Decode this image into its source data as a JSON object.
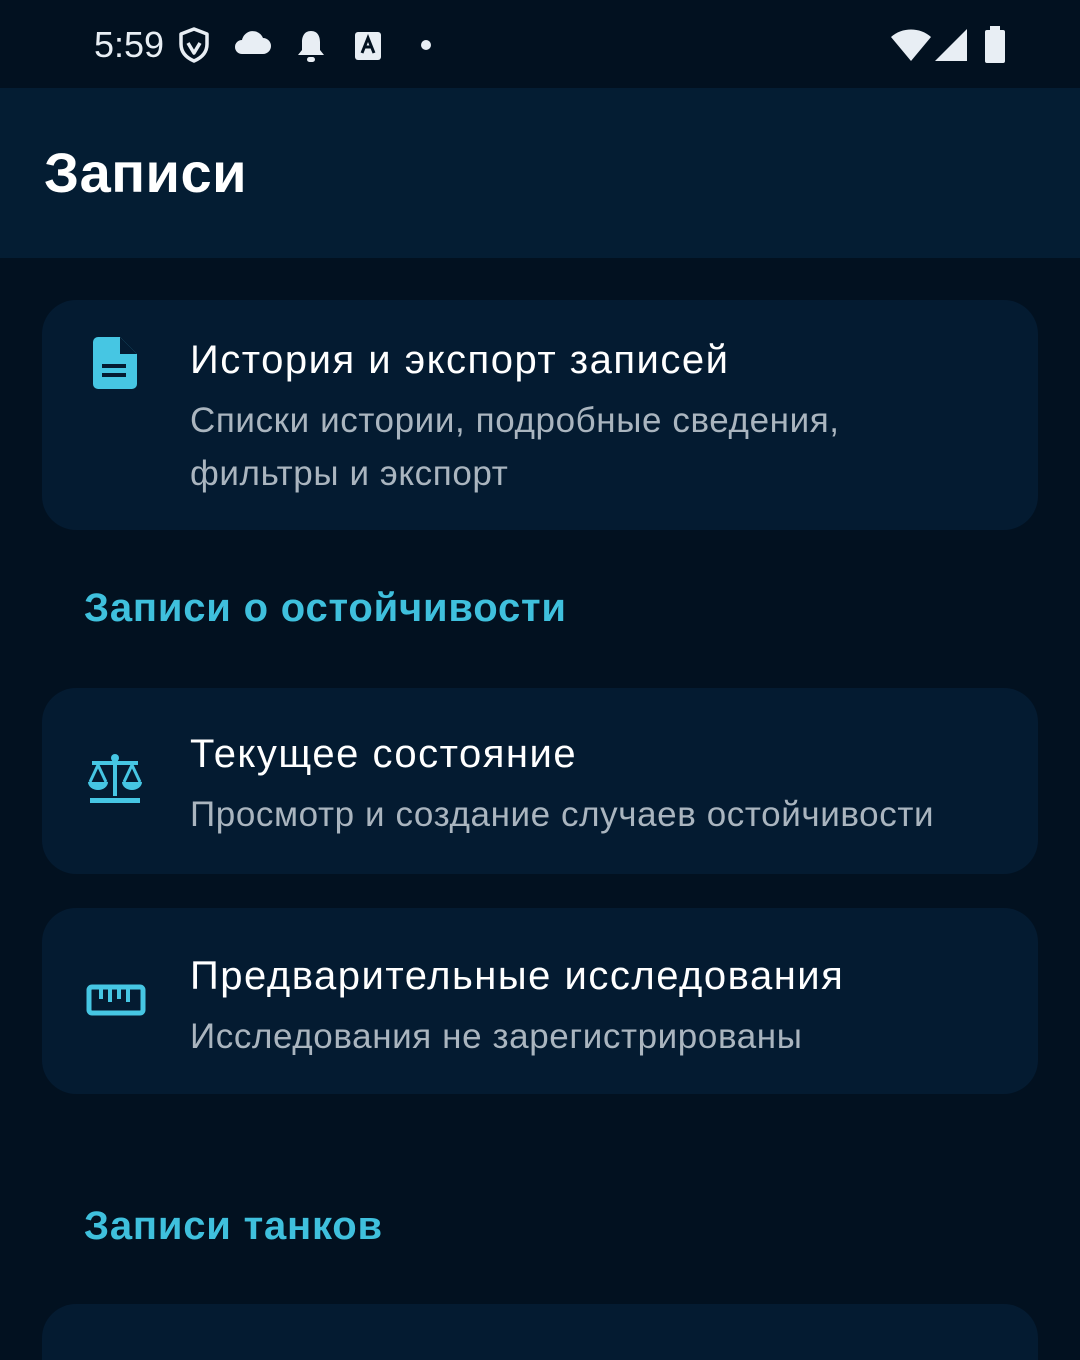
{
  "status_bar": {
    "time": "5:59",
    "icons_left": [
      "shield-icon",
      "cloud-icon",
      "bell-icon",
      "keyboard-a-icon",
      "dot-icon"
    ],
    "icons_right": [
      "wifi-icon",
      "signal-icon",
      "battery-icon"
    ]
  },
  "app_bar": {
    "title": "Записи"
  },
  "cards": {
    "history": {
      "icon": "document-icon",
      "title": "История и экспорт записей",
      "subtitle": "Списки истории, подробные сведения, фильтры и экспорт"
    },
    "current_state": {
      "icon": "scales-icon",
      "title": "Текущее состояние",
      "subtitle": "Просмотр и создание случаев остойчивости"
    },
    "preliminary": {
      "icon": "ruler-icon",
      "title": "Предварительные исследования",
      "subtitle": "Исследования не зарегистрированы"
    }
  },
  "sections": {
    "stability": "Записи о остойчивости",
    "tanks": "Записи танков"
  },
  "colors": {
    "background": "#021120",
    "app_bar": "#041d33",
    "card": "#041b31",
    "accent": "#3fc0dd",
    "title_text": "#ffffff",
    "subtitle_text": "#aab5bf"
  }
}
